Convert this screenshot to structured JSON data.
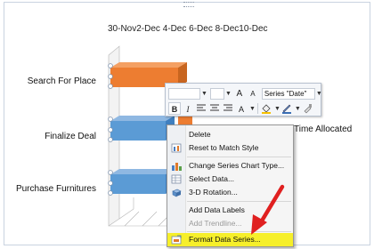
{
  "chart": {
    "tick_labels": "30-Nov2-Dec 4-Dec 6-Dec 8-Dec10-Dec",
    "categories": [
      "Search For Place",
      "Finalize Deal",
      "Purchase Furnitures"
    ],
    "legend_label": "Time Allocated",
    "bar_color_selected": "#5b9bd5",
    "bar_color_series": "#ed7d31"
  },
  "chart_data": {
    "type": "bar",
    "orientation": "horizontal",
    "categories": [
      "Search For Place",
      "Finalize Deal",
      "Purchase Furnitures"
    ],
    "series": [
      {
        "name": "Time Allocated"
      }
    ],
    "x_ticks": [
      "30-Nov",
      "2-Dec",
      "4-Dec",
      "6-Dec",
      "8-Dec",
      "10-Dec"
    ]
  },
  "mini_toolbar": {
    "series_select": "Series \"Date\"",
    "grow_font": "A",
    "shrink_font": "A",
    "bold": "B",
    "italic": "I",
    "font_color": "A"
  },
  "context_menu": {
    "items": [
      {
        "label": "Delete",
        "disabled": false
      },
      {
        "label": "Reset to Match Style",
        "disabled": false
      },
      {
        "label": "Change Series Chart Type...",
        "disabled": false
      },
      {
        "label": "Select Data...",
        "disabled": false
      },
      {
        "label": "3-D Rotation...",
        "disabled": false
      },
      {
        "label": "Add Data Labels",
        "disabled": false
      },
      {
        "label": "Add Trendline...",
        "disabled": true
      },
      {
        "label": "Format Data Series...",
        "disabled": false,
        "highlighted": true
      }
    ]
  },
  "colors": {
    "highlight": "#f6ef2a",
    "arrow": "#e02020"
  }
}
